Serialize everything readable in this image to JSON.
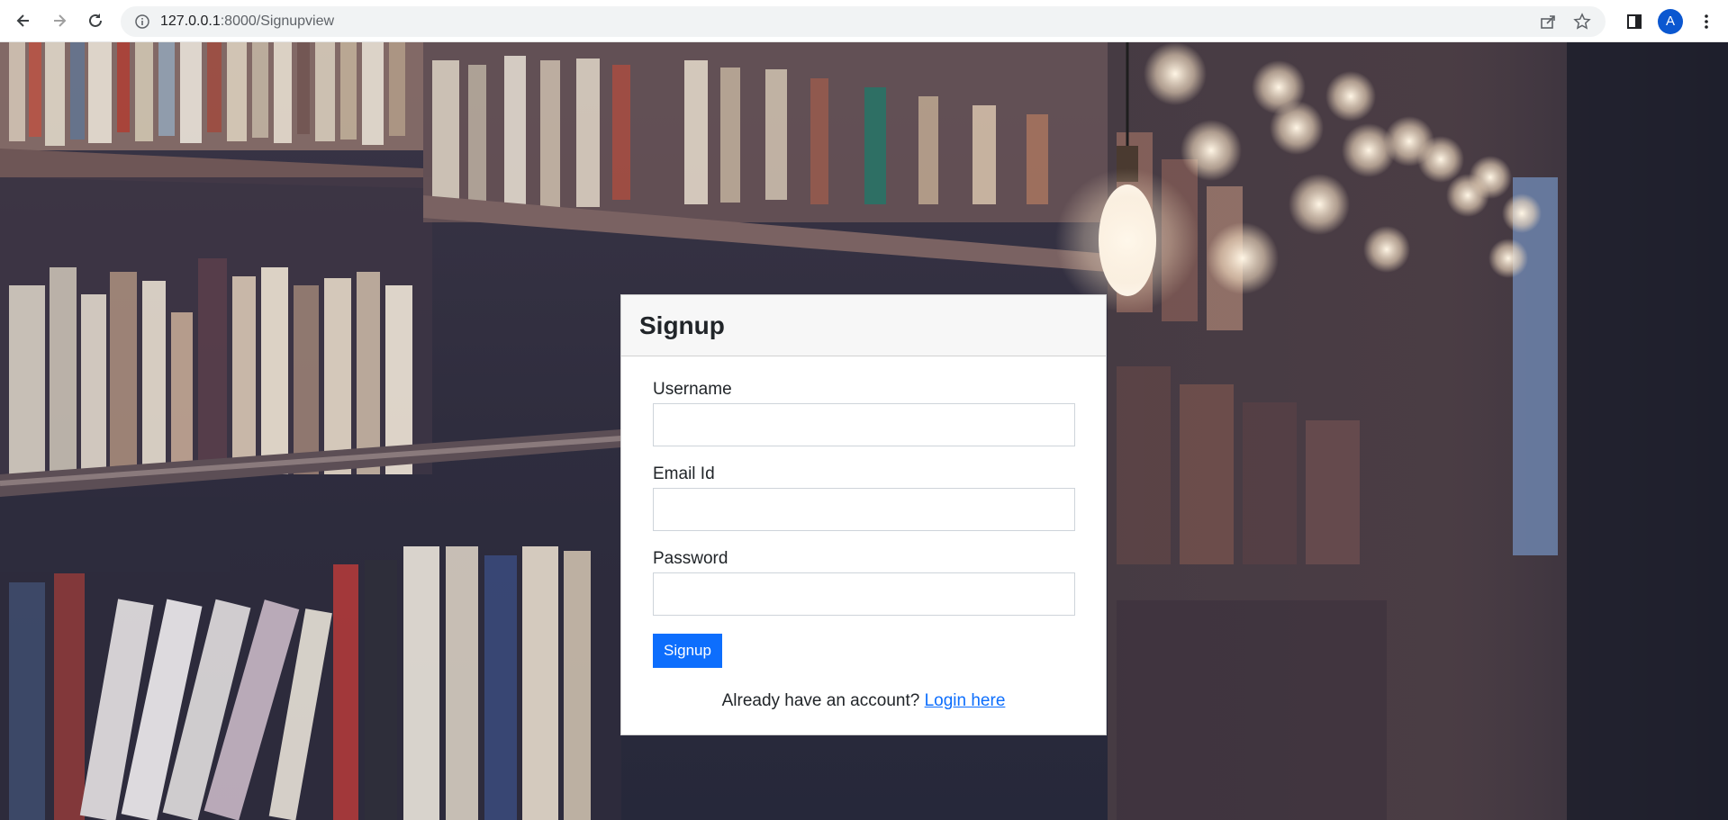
{
  "browser": {
    "url_host": "127.0.0.1",
    "url_path": ":8000/Signupview",
    "profile_initial": "A"
  },
  "card": {
    "title": "Signup",
    "fields": [
      {
        "label": "Username",
        "value": ""
      },
      {
        "label": "Email Id",
        "value": ""
      },
      {
        "label": "Password",
        "value": ""
      }
    ],
    "submit_label": "Signup",
    "login_prompt": "Already have an account?",
    "login_link": "Login here"
  },
  "colors": {
    "primary": "#0d6efd",
    "profile": "#0b57d0"
  }
}
